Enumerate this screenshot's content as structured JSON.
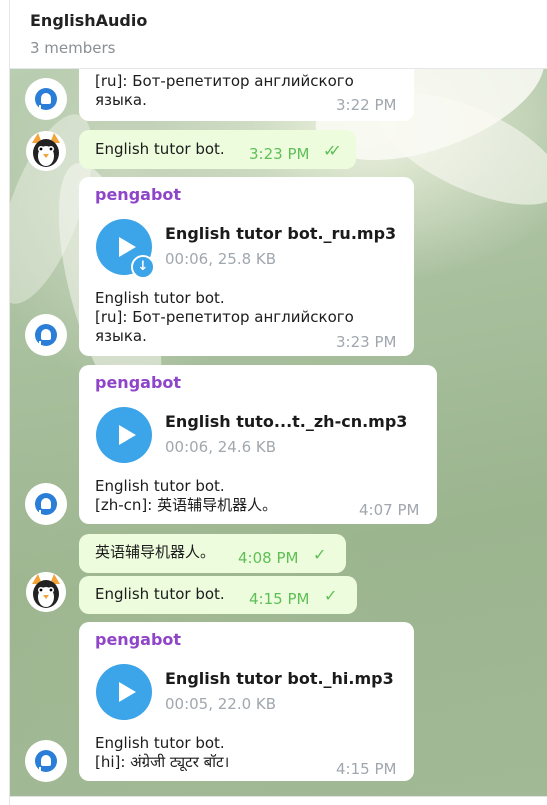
{
  "header": {
    "title": "EnglishAudio",
    "subtitle": "3 members"
  },
  "messages": {
    "m1": {
      "line1": "[ru]: Бот-репетитор английского",
      "line2": "языка.",
      "time": "3:22 PM"
    },
    "m2": {
      "text": "English tutor bot.",
      "time": "3:23 PM",
      "status_icon": "double-check-icon"
    },
    "m3": {
      "sender": "pengabot",
      "file_name": "English tutor bot._ru.mp3",
      "file_meta": "00:06, 25.8 KB",
      "line1": "English tutor bot.",
      "line2": "[ru]: Бот-репетитор английского",
      "line3": "языка.",
      "time": "3:23 PM"
    },
    "m4": {
      "sender": "pengabot",
      "file_name": "English tuto...t._zh-cn.mp3",
      "file_meta": "00:06, 24.6 KB",
      "line1": "English tutor bot.",
      "line2": "[zh-cn]: 英语辅导机器人。",
      "time": "4:07 PM"
    },
    "m5": {
      "text": "英语辅导机器人。",
      "time": "4:08 PM",
      "status_icon": "check-icon"
    },
    "m6": {
      "text": "English tutor bot.",
      "time": "4:15 PM",
      "status_icon": "check-icon"
    },
    "m7": {
      "sender": "pengabot",
      "file_name": "English tutor bot._hi.mp3",
      "file_meta": "00:05, 22.0 KB",
      "line1": "English tutor bot.",
      "line2": "[hi]: अंग्रेजी ट्यूटर बॉट।",
      "time": "4:15 PM"
    }
  },
  "colors": {
    "accent": "#3ca4e8",
    "sender": "#8f45c9",
    "outgoing_bubble": "#eefcde",
    "check": "#5fbf57"
  }
}
